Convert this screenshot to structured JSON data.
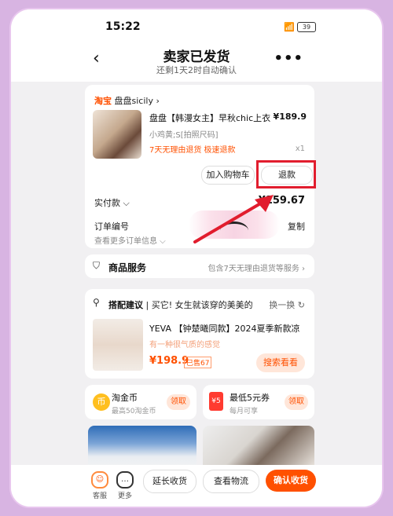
{
  "status": {
    "time": "15:22",
    "signal": "📶",
    "battery": "39"
  },
  "nav": {
    "back": "‹",
    "title": "卖家已发货",
    "subtitle": "还剩1天2时自动确认",
    "more": "•••"
  },
  "order": {
    "shop_brand": "淘宝",
    "shop_name": "盘盘sicily",
    "shop_arrow": "›",
    "product_title": "盘盘【韩漫女主】早秋chic上衣",
    "product_price": "¥189.9",
    "product_spec": "小鸡黄;S[拍照尺码]",
    "product_tags": "7天无理由退货  极速退款",
    "product_qty": "x1",
    "add_to_cart": "加入购物车",
    "refund": "退款",
    "paid_label": "实付款 ⌵",
    "paid_value": "¥159.67",
    "order_no_label": "订单编号",
    "order_more": "查看更多订单信息 ⌵",
    "copy": "复制"
  },
  "service": {
    "label": "商品服务",
    "detail": "包含7天无理由退货等服务 ›"
  },
  "suggestion": {
    "header_bold": "搭配建议",
    "header_text": "买它! 女生就该穿的美美的",
    "refresh": "换一换 ↻",
    "title": "YEVA 【钟楚曦同款】2024夏季新款凉",
    "subtitle": "有一种很气质的感觉",
    "price": "¥198.9",
    "sold": "已售67",
    "search_btn": "搜索看看"
  },
  "rewards": [
    {
      "title": "淘金币",
      "sub": "最高50淘金币",
      "btn": "领取",
      "icon": "币"
    },
    {
      "title": "最低5元券",
      "sub": "每月可享",
      "btn": "领取",
      "icon": "¥5"
    }
  ],
  "bottom": {
    "service": "客服",
    "service_icon": "☺",
    "more": "更多",
    "more_icon": "…",
    "extend": "延长收货",
    "logistics": "查看物流",
    "confirm": "确认收货"
  },
  "colors": {
    "accent": "#ff5000",
    "highlight_box": "#e11d2e",
    "frame": "#d8b4e2"
  }
}
